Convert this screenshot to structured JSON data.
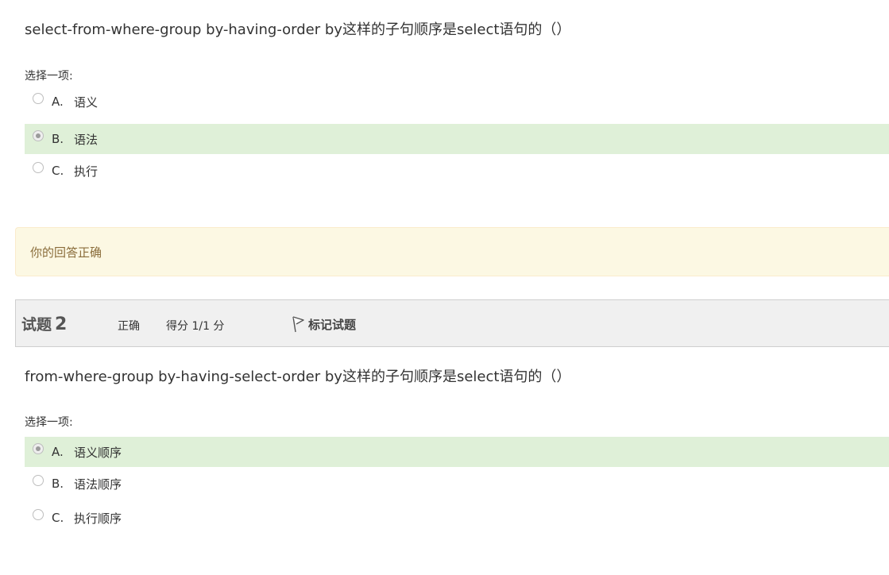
{
  "question1": {
    "text": "select-from-where-group by-having-order by这样的子句顺序是select语句的（）",
    "prompt": "选择一项:",
    "options": [
      {
        "letter": "A.",
        "text": "语义",
        "selected": false
      },
      {
        "letter": "B.",
        "text": "语法",
        "selected": true
      },
      {
        "letter": "C.",
        "text": "执行",
        "selected": false
      }
    ],
    "feedback": "你的回答正确"
  },
  "question2": {
    "label": "试题",
    "number": "2",
    "state": "正确",
    "grade": "得分 1/1 分",
    "flag_label": "标记试题",
    "text": "from-where-group by-having-select-order by这样的子句顺序是select语句的（）",
    "prompt": "选择一项:",
    "options": [
      {
        "letter": "A.",
        "text": "语义顺序",
        "selected": true
      },
      {
        "letter": "B.",
        "text": "语法顺序",
        "selected": false
      },
      {
        "letter": "C.",
        "text": "执行顺序",
        "selected": false
      }
    ]
  },
  "colors": {
    "selected_bg": "#dff0d8",
    "feedback_bg": "#fcf8e3",
    "feedback_text": "#8a6d3b",
    "header_bg": "#f0f0f0"
  }
}
